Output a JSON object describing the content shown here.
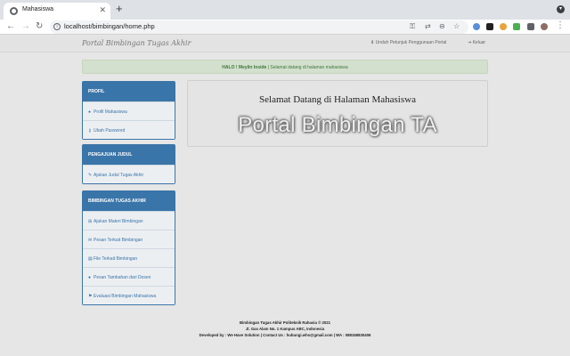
{
  "browser": {
    "tab_title": "Mahasiswa",
    "tab_close": "✕",
    "new_tab": "+",
    "url": "localhost/bimbingan/home.php",
    "nav": {
      "back": "←",
      "forward": "→",
      "reload": "↻"
    }
  },
  "header": {
    "brand": "Portal Bimbingan Tugas Akhir",
    "guide_link": "Unduh Petunjuk Penggunaan Portal",
    "logout_link": "Keluar"
  },
  "alert": {
    "greeting": "HALO",
    "separator": "!",
    "user": "Meylin Inside",
    "message": "| Selamat datang di halaman mahasiswa"
  },
  "sidebar": {
    "profil": {
      "title": "PROFIL",
      "items": [
        {
          "label": "Profil Mahasiswa",
          "icon": "user-icon"
        },
        {
          "label": "Ubah Password",
          "icon": "key-icon"
        }
      ]
    },
    "judul": {
      "title": "PENGAJUAN JUDUL",
      "items": [
        {
          "label": "Ajukan Judul Tugas Akhir",
          "icon": "pencil-icon"
        }
      ]
    },
    "bimbingan": {
      "title": "BIMBINGAN TUGAS AKHIR",
      "items": [
        {
          "label": "Ajukan Materi Bimbingan",
          "icon": "plus-square-icon"
        },
        {
          "label": "Pesan Terkait Bimbingan",
          "icon": "envelope-icon"
        },
        {
          "label": "File Terkait Bimbingan",
          "icon": "file-icon"
        },
        {
          "label": "Pesan Tambahan dari Dosen",
          "icon": "comment-icon"
        },
        {
          "label": "Evaluasi Bimbingan Mahasiswa",
          "icon": "flag-icon"
        }
      ]
    }
  },
  "welcome": {
    "title": "Selamat Datang di Halaman Mahasiswa",
    "big": "Portal Bimbingan TA"
  },
  "footer": {
    "line1": "Bimbingan Tugas Akhir Politeknik Rahasia © 2021",
    "line2": "Jl. Gas Alam No. 1 Kampus ABC, Indonesia",
    "line3": "Developed by : We Have Solution | Contact Us : hubungi.whs@gmail.com | WA : 088158830406"
  },
  "colors": {
    "panel_blue": "#3a75a9",
    "alert_green_bg": "#d3e0cd",
    "alert_green_text": "#3c763d"
  }
}
